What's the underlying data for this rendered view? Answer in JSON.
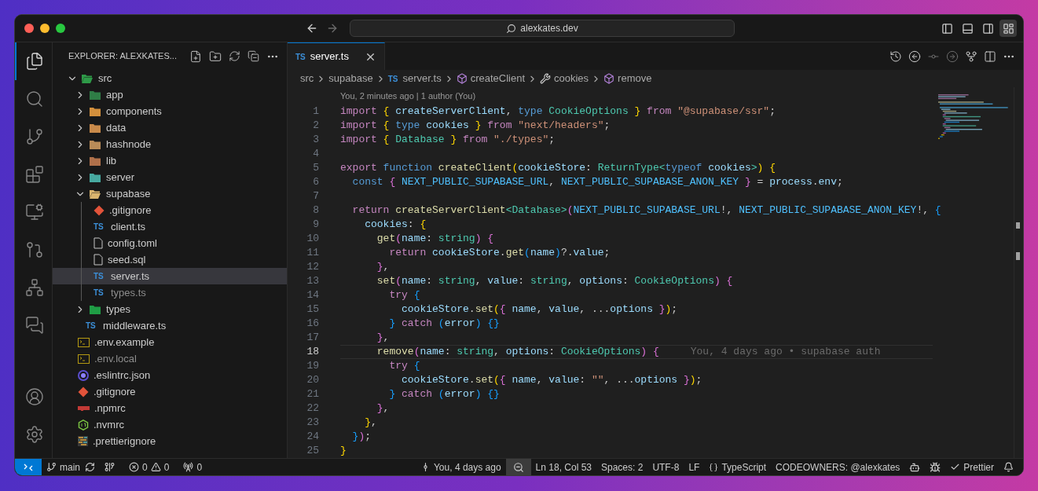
{
  "title_bar": {
    "search": "alexkates.dev",
    "layout_buttons": [
      {
        "kind": "primary-sidebar",
        "selected": false
      },
      {
        "kind": "panel",
        "selected": false
      },
      {
        "kind": "secondary-sidebar",
        "selected": false
      },
      {
        "kind": "customize-layout",
        "selected": true
      }
    ]
  },
  "activity_bar": {
    "top": [
      {
        "kind": "explorer",
        "selected": true
      },
      {
        "kind": "search",
        "selected": false
      },
      {
        "kind": "source-control",
        "selected": false
      },
      {
        "kind": "extensions",
        "selected": false
      },
      {
        "kind": "remote",
        "selected": false
      },
      {
        "kind": "git-graph",
        "selected": false
      },
      {
        "kind": "containers",
        "selected": false
      },
      {
        "kind": "comments",
        "selected": false
      }
    ],
    "bottom": [
      {
        "kind": "account",
        "selected": false
      },
      {
        "kind": "settings",
        "selected": false
      }
    ]
  },
  "explorer": {
    "title": "EXPLORER: ALEXKATES...",
    "tree": [
      {
        "name": "src",
        "kind": "folder",
        "color": "#2e9a48",
        "expanded": true,
        "selected": false,
        "ignored": false,
        "children": [
          {
            "name": "app",
            "kind": "folder",
            "color": "#2f7d46",
            "expanded": false,
            "selected": false,
            "ignored": false
          },
          {
            "name": "components",
            "kind": "folder",
            "color": "#d38f3c",
            "expanded": false,
            "selected": false,
            "ignored": false
          },
          {
            "name": "data",
            "kind": "folder",
            "color": "#c98a4a",
            "expanded": false,
            "selected": false,
            "ignored": false
          },
          {
            "name": "hashnode",
            "kind": "folder",
            "color": "#b98b58",
            "expanded": false,
            "selected": false,
            "ignored": false
          },
          {
            "name": "lib",
            "kind": "folder",
            "color": "#b0704a",
            "expanded": false,
            "selected": false,
            "ignored": false
          },
          {
            "name": "server",
            "kind": "folder",
            "color": "#47a9a0",
            "expanded": false,
            "selected": false,
            "ignored": false
          },
          {
            "name": "supabase",
            "kind": "folder",
            "color": "#d9b46e",
            "expanded": true,
            "selected": false,
            "ignored": false,
            "children": [
              {
                "name": ".gitignore",
                "kind": "git",
                "selected": false,
                "ignored": false
              },
              {
                "name": "client.ts",
                "kind": "ts",
                "badge": "TS",
                "selected": false,
                "ignored": false
              },
              {
                "name": "config.toml",
                "kind": "file",
                "selected": false,
                "ignored": false
              },
              {
                "name": "seed.sql",
                "kind": "file",
                "selected": false,
                "ignored": false
              },
              {
                "name": "server.ts",
                "kind": "ts",
                "badge": "TS",
                "selected": true,
                "ignored": false
              },
              {
                "name": "types.ts",
                "kind": "ts",
                "badge": "TS",
                "selected": false,
                "ignored": true
              }
            ]
          },
          {
            "name": "types",
            "kind": "folder",
            "color": "#1f9d45",
            "expanded": false,
            "selected": false,
            "ignored": false
          },
          {
            "name": "middleware.ts",
            "kind": "ts",
            "badge": "TS",
            "selected": false,
            "ignored": false
          }
        ]
      },
      {
        "name": ".env.example",
        "kind": "env",
        "selected": false,
        "ignored": false
      },
      {
        "name": ".env.local",
        "kind": "env",
        "selected": false,
        "ignored": true
      },
      {
        "name": ".eslintrc.json",
        "kind": "eslint",
        "selected": false,
        "ignored": false
      },
      {
        "name": ".gitignore",
        "kind": "git",
        "selected": false,
        "ignored": false
      },
      {
        "name": ".npmrc",
        "kind": "npm",
        "selected": false,
        "ignored": false
      },
      {
        "name": ".nvmrc",
        "kind": "node",
        "selected": false,
        "ignored": false
      },
      {
        "name": ".prettierignore",
        "kind": "prettier",
        "selected": false,
        "ignored": false
      }
    ]
  },
  "tabs": [
    {
      "badge": "TS",
      "label": "server.ts",
      "selected": true
    }
  ],
  "breadcrumbs": [
    {
      "kind": "folder",
      "label": "src"
    },
    {
      "kind": "folder",
      "label": "supabase"
    },
    {
      "kind": "ts",
      "badge": "TS",
      "label": "server.ts"
    },
    {
      "kind": "method",
      "label": "createClient"
    },
    {
      "kind": "property",
      "label": "cookies"
    },
    {
      "kind": "method",
      "label": "remove"
    }
  ],
  "code": {
    "codelens": "You, 2 minutes ago | 1 author (You)",
    "lines": [
      {
        "n": "1",
        "current": false,
        "tokens": [
          {
            "kind": "kw",
            "text": "import "
          },
          {
            "kind": "b1",
            "text": "{ "
          },
          {
            "kind": "v",
            "text": "createServerClient"
          },
          {
            "kind": "p",
            "text": ", "
          },
          {
            "kind": "st",
            "text": "type "
          },
          {
            "kind": "t",
            "text": "CookieOptions"
          },
          {
            "kind": "b1",
            "text": " }"
          },
          {
            "kind": "kw",
            "text": " from "
          },
          {
            "kind": "s",
            "text": "\"@supabase/ssr\""
          },
          {
            "kind": "p",
            "text": ";"
          }
        ]
      },
      {
        "n": "2",
        "current": false,
        "tokens": [
          {
            "kind": "kw",
            "text": "import "
          },
          {
            "kind": "b1",
            "text": "{ "
          },
          {
            "kind": "st",
            "text": "type "
          },
          {
            "kind": "v",
            "text": "cookies"
          },
          {
            "kind": "b1",
            "text": " }"
          },
          {
            "kind": "kw",
            "text": " from "
          },
          {
            "kind": "s",
            "text": "\"next/headers\""
          },
          {
            "kind": "p",
            "text": ";"
          }
        ]
      },
      {
        "n": "3",
        "current": false,
        "tokens": [
          {
            "kind": "kw",
            "text": "import "
          },
          {
            "kind": "b1",
            "text": "{ "
          },
          {
            "kind": "t",
            "text": "Database"
          },
          {
            "kind": "b1",
            "text": " }"
          },
          {
            "kind": "kw",
            "text": " from "
          },
          {
            "kind": "s",
            "text": "\"./types\""
          },
          {
            "kind": "p",
            "text": ";"
          }
        ]
      },
      {
        "n": "4",
        "current": false
      },
      {
        "n": "5",
        "current": false,
        "tokens": [
          {
            "kind": "kw",
            "text": "export "
          },
          {
            "kind": "st",
            "text": "function "
          },
          {
            "kind": "fn",
            "text": "createClient"
          },
          {
            "kind": "b1",
            "text": "("
          },
          {
            "kind": "v",
            "text": "cookieStore"
          },
          {
            "kind": "p",
            "text": ": "
          },
          {
            "kind": "t",
            "text": "ReturnType<"
          },
          {
            "kind": "st",
            "text": "typeof "
          },
          {
            "kind": "v",
            "text": "cookies"
          },
          {
            "kind": "t",
            "text": ">"
          },
          {
            "kind": "b1",
            "text": ") {"
          }
        ]
      },
      {
        "n": "6",
        "current": false,
        "tokens": [
          {
            "kind": "st",
            "text": "  const "
          },
          {
            "kind": "b2",
            "text": "{ "
          },
          {
            "kind": "c",
            "text": "NEXT_PUBLIC_SUPABASE_URL"
          },
          {
            "kind": "p",
            "text": ", "
          },
          {
            "kind": "c",
            "text": "NEXT_PUBLIC_SUPABASE_ANON_KEY"
          },
          {
            "kind": "b2",
            "text": " }"
          },
          {
            "kind": "p",
            "text": " = "
          },
          {
            "kind": "v",
            "text": "process"
          },
          {
            "kind": "p",
            "text": "."
          },
          {
            "kind": "v",
            "text": "env"
          },
          {
            "kind": "p",
            "text": ";"
          }
        ]
      },
      {
        "n": "7",
        "current": false
      },
      {
        "n": "8",
        "current": false,
        "tokens": [
          {
            "kind": "kw",
            "text": "  return "
          },
          {
            "kind": "fn",
            "text": "createServerClient"
          },
          {
            "kind": "t",
            "text": "<Database>"
          },
          {
            "kind": "b2",
            "text": "("
          },
          {
            "kind": "c",
            "text": "NEXT_PUBLIC_SUPABASE_URL"
          },
          {
            "kind": "p",
            "text": "!, "
          },
          {
            "kind": "c",
            "text": "NEXT_PUBLIC_SUPABASE_ANON_KEY"
          },
          {
            "kind": "p",
            "text": "!, "
          },
          {
            "kind": "b3",
            "text": "{"
          }
        ]
      },
      {
        "n": "9",
        "current": false,
        "tokens": [
          {
            "kind": "v",
            "text": "    cookies"
          },
          {
            "kind": "p",
            "text": ": "
          },
          {
            "kind": "b1",
            "text": "{"
          }
        ]
      },
      {
        "n": "10",
        "current": false,
        "tokens": [
          {
            "kind": "fn",
            "text": "      get"
          },
          {
            "kind": "b2",
            "text": "("
          },
          {
            "kind": "v",
            "text": "name"
          },
          {
            "kind": "p",
            "text": ": "
          },
          {
            "kind": "t",
            "text": "string"
          },
          {
            "kind": "b2",
            "text": ") {"
          }
        ]
      },
      {
        "n": "11",
        "current": false,
        "tokens": [
          {
            "kind": "kw",
            "text": "        return "
          },
          {
            "kind": "v",
            "text": "cookieStore"
          },
          {
            "kind": "p",
            "text": "."
          },
          {
            "kind": "fn",
            "text": "get"
          },
          {
            "kind": "b3",
            "text": "("
          },
          {
            "kind": "v",
            "text": "name"
          },
          {
            "kind": "b3",
            "text": ")"
          },
          {
            "kind": "p",
            "text": "?."
          },
          {
            "kind": "v",
            "text": "value"
          },
          {
            "kind": "p",
            "text": ";"
          }
        ]
      },
      {
        "n": "12",
        "current": false,
        "tokens": [
          {
            "kind": "b2",
            "text": "      }"
          },
          {
            "kind": "p",
            "text": ","
          }
        ]
      },
      {
        "n": "13",
        "current": false,
        "tokens": [
          {
            "kind": "fn",
            "text": "      set"
          },
          {
            "kind": "b2",
            "text": "("
          },
          {
            "kind": "v",
            "text": "name"
          },
          {
            "kind": "p",
            "text": ": "
          },
          {
            "kind": "t",
            "text": "string"
          },
          {
            "kind": "p",
            "text": ", "
          },
          {
            "kind": "v",
            "text": "value"
          },
          {
            "kind": "p",
            "text": ": "
          },
          {
            "kind": "t",
            "text": "string"
          },
          {
            "kind": "p",
            "text": ", "
          },
          {
            "kind": "v",
            "text": "options"
          },
          {
            "kind": "p",
            "text": ": "
          },
          {
            "kind": "t",
            "text": "CookieOptions"
          },
          {
            "kind": "b2",
            "text": ") {"
          }
        ]
      },
      {
        "n": "14",
        "current": false,
        "tokens": [
          {
            "kind": "kw",
            "text": "        try "
          },
          {
            "kind": "b3",
            "text": "{"
          }
        ]
      },
      {
        "n": "15",
        "current": false,
        "tokens": [
          {
            "kind": "v",
            "text": "          cookieStore"
          },
          {
            "kind": "p",
            "text": "."
          },
          {
            "kind": "fn",
            "text": "set"
          },
          {
            "kind": "b1",
            "text": "("
          },
          {
            "kind": "b2",
            "text": "{ "
          },
          {
            "kind": "v",
            "text": "name"
          },
          {
            "kind": "p",
            "text": ", "
          },
          {
            "kind": "v",
            "text": "value"
          },
          {
            "kind": "p",
            "text": ", ..."
          },
          {
            "kind": "v",
            "text": "options"
          },
          {
            "kind": "b2",
            "text": " }"
          },
          {
            "kind": "b1",
            "text": ")"
          },
          {
            "kind": "p",
            "text": ";"
          }
        ]
      },
      {
        "n": "16",
        "current": false,
        "tokens": [
          {
            "kind": "b3",
            "text": "        }"
          },
          {
            "kind": "kw",
            "text": " catch "
          },
          {
            "kind": "b3",
            "text": "("
          },
          {
            "kind": "v",
            "text": "error"
          },
          {
            "kind": "b3",
            "text": ") {}"
          }
        ]
      },
      {
        "n": "17",
        "current": false,
        "tokens": [
          {
            "kind": "b2",
            "text": "      }"
          },
          {
            "kind": "p",
            "text": ","
          }
        ]
      },
      {
        "n": "18",
        "current": true,
        "blame": "You, 4 days ago • supabase auth",
        "tokens": [
          {
            "kind": "fn",
            "text": "      remove"
          },
          {
            "kind": "b2",
            "text": "("
          },
          {
            "kind": "v",
            "text": "name"
          },
          {
            "kind": "p",
            "text": ": "
          },
          {
            "kind": "t",
            "text": "string"
          },
          {
            "kind": "p",
            "text": ", "
          },
          {
            "kind": "v",
            "text": "options"
          },
          {
            "kind": "p",
            "text": ": "
          },
          {
            "kind": "t",
            "text": "CookieOptions"
          },
          {
            "kind": "b2",
            "text": ") {"
          }
        ]
      },
      {
        "n": "19",
        "current": false,
        "tokens": [
          {
            "kind": "kw",
            "text": "        try "
          },
          {
            "kind": "b3",
            "text": "{"
          }
        ]
      },
      {
        "n": "20",
        "current": false,
        "tokens": [
          {
            "kind": "v",
            "text": "          cookieStore"
          },
          {
            "kind": "p",
            "text": "."
          },
          {
            "kind": "fn",
            "text": "set"
          },
          {
            "kind": "b1",
            "text": "("
          },
          {
            "kind": "b2",
            "text": "{ "
          },
          {
            "kind": "v",
            "text": "name"
          },
          {
            "kind": "p",
            "text": ", "
          },
          {
            "kind": "v",
            "text": "value"
          },
          {
            "kind": "p",
            "text": ": "
          },
          {
            "kind": "s",
            "text": "\"\""
          },
          {
            "kind": "p",
            "text": ", ..."
          },
          {
            "kind": "v",
            "text": "options"
          },
          {
            "kind": "b2",
            "text": " }"
          },
          {
            "kind": "b1",
            "text": ")"
          },
          {
            "kind": "p",
            "text": ";"
          }
        ]
      },
      {
        "n": "21",
        "current": false,
        "tokens": [
          {
            "kind": "b3",
            "text": "        }"
          },
          {
            "kind": "kw",
            "text": " catch "
          },
          {
            "kind": "b3",
            "text": "("
          },
          {
            "kind": "v",
            "text": "error"
          },
          {
            "kind": "b3",
            "text": ") {}"
          }
        ]
      },
      {
        "n": "22",
        "current": false,
        "tokens": [
          {
            "kind": "b2",
            "text": "      }"
          },
          {
            "kind": "p",
            "text": ","
          }
        ]
      },
      {
        "n": "23",
        "current": false,
        "tokens": [
          {
            "kind": "b1",
            "text": "    }"
          },
          {
            "kind": "p",
            "text": ","
          }
        ]
      },
      {
        "n": "24",
        "current": false,
        "tokens": [
          {
            "kind": "b3",
            "text": "  }"
          },
          {
            "kind": "b2",
            "text": ")"
          },
          {
            "kind": "p",
            "text": ";"
          }
        ]
      },
      {
        "n": "25",
        "current": false,
        "tokens": [
          {
            "kind": "b1",
            "text": "}"
          }
        ]
      }
    ]
  },
  "status_bar": {
    "left": [
      {
        "kind": "remote"
      },
      {
        "kind": "branch",
        "text": "main"
      },
      {
        "kind": "git-graph"
      },
      {
        "kind": "problems",
        "errors": "0",
        "warnings": "0"
      },
      {
        "kind": "ports",
        "text": "0"
      }
    ],
    "right": [
      {
        "kind": "blame",
        "text": "You, 4 days ago"
      },
      {
        "kind": "zoom"
      },
      {
        "kind": "text",
        "text": "Ln 18, Col 53"
      },
      {
        "kind": "text",
        "text": "Spaces: 2"
      },
      {
        "kind": "text",
        "text": "UTF-8"
      },
      {
        "kind": "text",
        "text": "LF"
      },
      {
        "kind": "language",
        "text": "TypeScript"
      },
      {
        "kind": "text",
        "text": "CODEOWNERS: @alexkates"
      },
      {
        "kind": "copilot"
      },
      {
        "kind": "feedback"
      },
      {
        "kind": "prettier",
        "text": "Prettier"
      },
      {
        "kind": "bell"
      }
    ]
  }
}
